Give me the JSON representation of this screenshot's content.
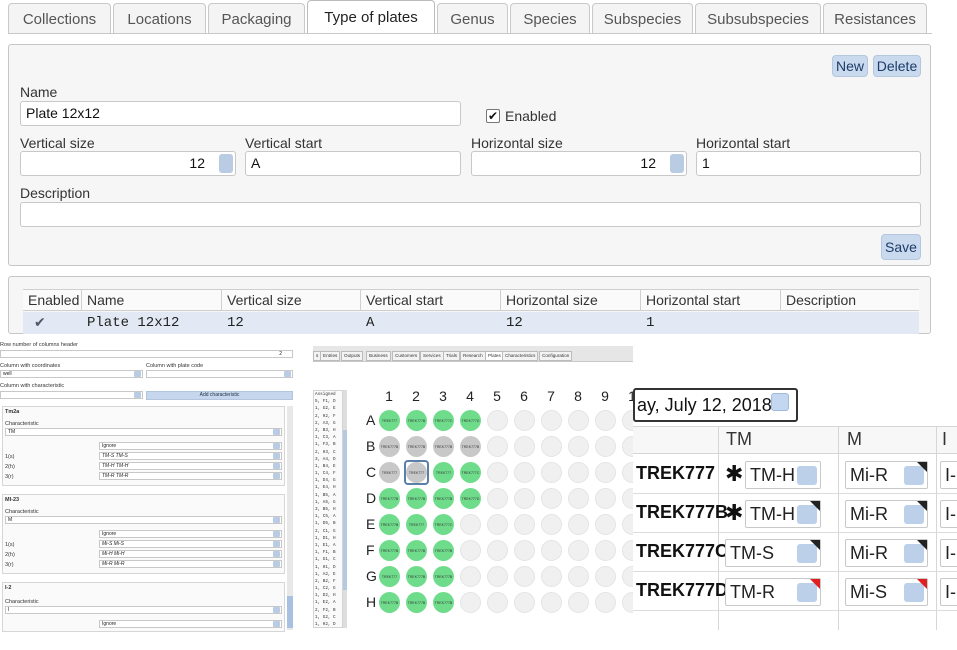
{
  "tabs": [
    "Collections",
    "Locations",
    "Packaging",
    "Type of plates",
    "Genus",
    "Species",
    "Subspecies",
    "Subsubspecies",
    "Resistances"
  ],
  "active_tab": "Type of plates",
  "form": {
    "new_label": "New",
    "delete_label": "Delete",
    "save_label": "Save",
    "name_label": "Name",
    "name_value": "Plate 12x12",
    "enabled_label": "Enabled",
    "enabled_checked": true,
    "vertical_size_label": "Vertical size",
    "vertical_size_value": "12",
    "vertical_start_label": "Vertical start",
    "vertical_start_value": "A",
    "horizontal_size_label": "Horizontal size",
    "horizontal_size_value": "12",
    "horizontal_start_label": "Horizontal start",
    "horizontal_start_value": "1",
    "description_label": "Description",
    "description_value": ""
  },
  "table": {
    "headers": [
      "Enabled",
      "Name",
      "Vertical size",
      "Vertical start",
      "Horizontal size",
      "Horizontal start",
      "Description"
    ],
    "rows": [
      {
        "enabled": "✔",
        "name": "Plate 12x12",
        "vertical_size": "12",
        "vertical_start": "A",
        "horizontal_size": "12",
        "horizontal_start": "1",
        "description": ""
      }
    ]
  },
  "import_panel": {
    "header_row_label": "Row number of columns header",
    "header_row_value": "2",
    "coords_label": "Column with coordinates",
    "coords_value": "well",
    "plate_code_label": "Column with plate code",
    "characteristic_col_label": "Column with characteristic",
    "add_characteristic_label": "Add characteristic",
    "sections": [
      {
        "title": "Tm2a",
        "char_label": "Characteristic",
        "char_value": "TM",
        "ignore_label": "Ignore",
        "mappings": [
          [
            "1(s)",
            "TM-S  TM-S"
          ],
          [
            "2(h)",
            "TM-H  TM-H"
          ],
          [
            "3(r)",
            "TM-R  TM-R"
          ]
        ]
      },
      {
        "title": "MI-23",
        "char_label": "Characteristic",
        "char_value": "M",
        "ignore_label": "Ignore",
        "mappings": [
          [
            "1(s)",
            "Mi-S  Mi-S"
          ],
          [
            "2(h)",
            "Mi-H  Mi-H"
          ],
          [
            "3(r)",
            "Mi-R  Mi-R"
          ]
        ]
      },
      {
        "title": "I-2",
        "char_label": "Characteristic",
        "char_value": "I",
        "ignore_label": "Ignore",
        "mappings": []
      }
    ]
  },
  "plate_view": {
    "top_tabs": [
      "s",
      "Entries",
      "Outputs",
      "Business",
      "Customers",
      "Services",
      "Trials",
      "Research",
      "Plates",
      "Characteristics",
      "Configuration"
    ],
    "active_top_tab": "Plates",
    "list_header": "Assigned",
    "list_items": [
      "5, F1, D",
      "1, G2, E",
      "2, H2, F",
      "2, A3, G",
      "2, B3, H",
      "1, C3, A",
      "1, F3, B",
      "2, H3, C",
      "3, A4, D",
      "1, B4, E",
      "1, C4, F",
      "1, D4, G",
      "1, E4, H",
      "1, B5, A",
      "1, A5, G",
      "3, B5, H",
      "1, C5, A",
      "1, D5, B",
      "2, C1, G",
      "1, D1, H",
      "1, E1, A",
      "1, F1, B",
      "1, G1, C",
      "1, H1, D",
      "1, A2, E",
      "2, B2, F",
      "1, C2, G",
      "1, D2, H",
      "1, E2, A",
      "2, F2, B",
      "1, G2, C",
      "1, H2, D",
      "1, A3, E"
    ],
    "columns": [
      "1",
      "2",
      "3",
      "4",
      "5",
      "6",
      "7",
      "8",
      "9",
      "1"
    ],
    "rows": [
      "A",
      "B",
      "C",
      "D",
      "E",
      "F",
      "G",
      "H"
    ],
    "well_text": "TREK777",
    "well_pattern": [
      [
        "g",
        "g",
        "g",
        "g",
        "e",
        "e",
        "e",
        "e",
        "e",
        "e"
      ],
      [
        "y",
        "y",
        "y",
        "y",
        "e",
        "e",
        "e",
        "e",
        "e",
        "e"
      ],
      [
        "y",
        "y",
        "g",
        "g",
        "e",
        "e",
        "e",
        "e",
        "e",
        "e"
      ],
      [
        "g",
        "g",
        "g",
        "g",
        "e",
        "e",
        "e",
        "e",
        "e",
        "e"
      ],
      [
        "g",
        "g",
        "g",
        "e",
        "e",
        "e",
        "e",
        "e",
        "e",
        "e"
      ],
      [
        "g",
        "g",
        "g",
        "e",
        "e",
        "e",
        "e",
        "e",
        "e",
        "e"
      ],
      [
        "g",
        "g",
        "g",
        "e",
        "e",
        "e",
        "e",
        "e",
        "e",
        "e"
      ],
      [
        "g",
        "g",
        "g",
        "e",
        "e",
        "e",
        "e",
        "e",
        "e",
        "e"
      ]
    ],
    "well_labels": [
      [
        "TREK777",
        "TREK777B",
        "TREK777C",
        "TREK777D"
      ],
      [
        "TREK777B",
        "TREK777B",
        "TREK777B",
        "TREK777B"
      ],
      [
        "TREK777",
        "TREK777",
        "TREK777",
        "TREK777C"
      ],
      [
        "TREK777B",
        "TREK777B",
        "TREK777B",
        "TREK777D"
      ],
      [
        "TREK777B",
        "TREK777",
        "TREK777C"
      ],
      [
        "TREK777B",
        "TREK777B",
        "TREK777B"
      ],
      [
        "TREK777",
        "TREK777B",
        "TREK777B"
      ],
      [
        "TREK777B",
        "TREK777B",
        "TREK777B"
      ]
    ],
    "selected_well": "C2"
  },
  "results": {
    "date_value": "ay, July 12, 2018",
    "headers": [
      "TM",
      "M",
      "I"
    ],
    "rows": [
      {
        "name": "TREK777",
        "asterisk": true,
        "tm": "TM-H",
        "m": "Mi-R",
        "i": "I-",
        "tm_flag": "",
        "m_flag": "black"
      },
      {
        "name": "TREK777B",
        "asterisk": true,
        "tm": "TM-H",
        "m": "Mi-R",
        "i": "I-",
        "tm_flag": "black",
        "m_flag": "black"
      },
      {
        "name": "TREK777C",
        "asterisk": false,
        "tm": "TM-S",
        "m": "Mi-R",
        "i": "I-",
        "tm_flag": "black",
        "m_flag": "black"
      },
      {
        "name": "TREK777D",
        "asterisk": false,
        "tm": "TM-R",
        "m": "Mi-S",
        "i": "I-",
        "tm_flag": "red",
        "m_flag": "red"
      }
    ]
  }
}
